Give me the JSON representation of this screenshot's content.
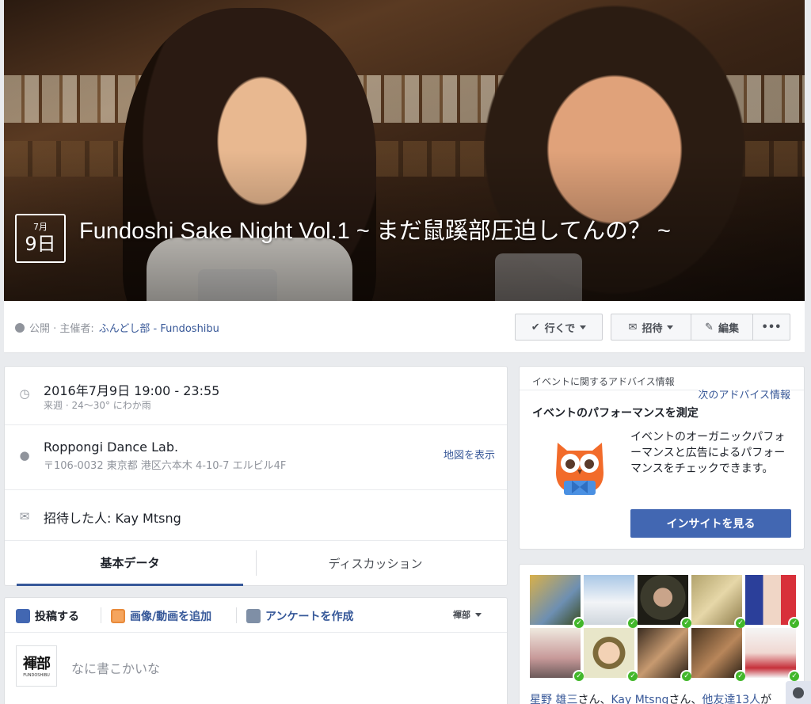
{
  "cover": {
    "month": "7月",
    "day": "9日",
    "title": "Fundoshi Sake Night Vol.1 ~ まだ鼠蹊部圧迫してんの？ ~"
  },
  "header": {
    "privacy_prefix": "公開 · 主催者: ",
    "host": "ふんどし部 - Fundoshibu",
    "going_label": "行くで",
    "invite_label": "招待",
    "edit_label": "編集",
    "more_label": "•••"
  },
  "details": {
    "datetime": "2016年7月9日 19:00 - 23:55",
    "weather": "来週 · 24〜30° にわか雨",
    "venue": "Roppongi Dance Lab.",
    "address": "〒106-0032 東京都 港区六本木 4-10-7 エルビル4F",
    "map_link": "地図を表示",
    "invited_by": "招待した人: Kay Mtsng",
    "tab_basic": "基本データ",
    "tab_discussion": "ディスカッション"
  },
  "composer": {
    "post": "投稿する",
    "photo": "画像/動画を追加",
    "poll": "アンケートを作成",
    "audience": "褌部",
    "avatar_main": "褌部",
    "avatar_sub": "FUNDOSHIBU",
    "placeholder": "なに書こかいな"
  },
  "tips": {
    "header": "イベントに関するアドバイス情報",
    "next_link": "次のアドバイス情報",
    "title": "イベントのパフォーマンスを測定",
    "body": "イベントのオーガニックパフォーマンスと広告によるパフォーマンスをチェックできます。",
    "button": "インサイトを見る"
  },
  "friends": {
    "name1": "星野 雄三",
    "suffix1": "さん、",
    "name2": "Kay Mtsng",
    "suffix2": "さん、",
    "others": "他友達13人",
    "tail": "が"
  },
  "colors": {
    "link": "#385898",
    "primary_button": "#4267b2",
    "check": "#42b72a",
    "owl_orange": "#f26b2a"
  }
}
